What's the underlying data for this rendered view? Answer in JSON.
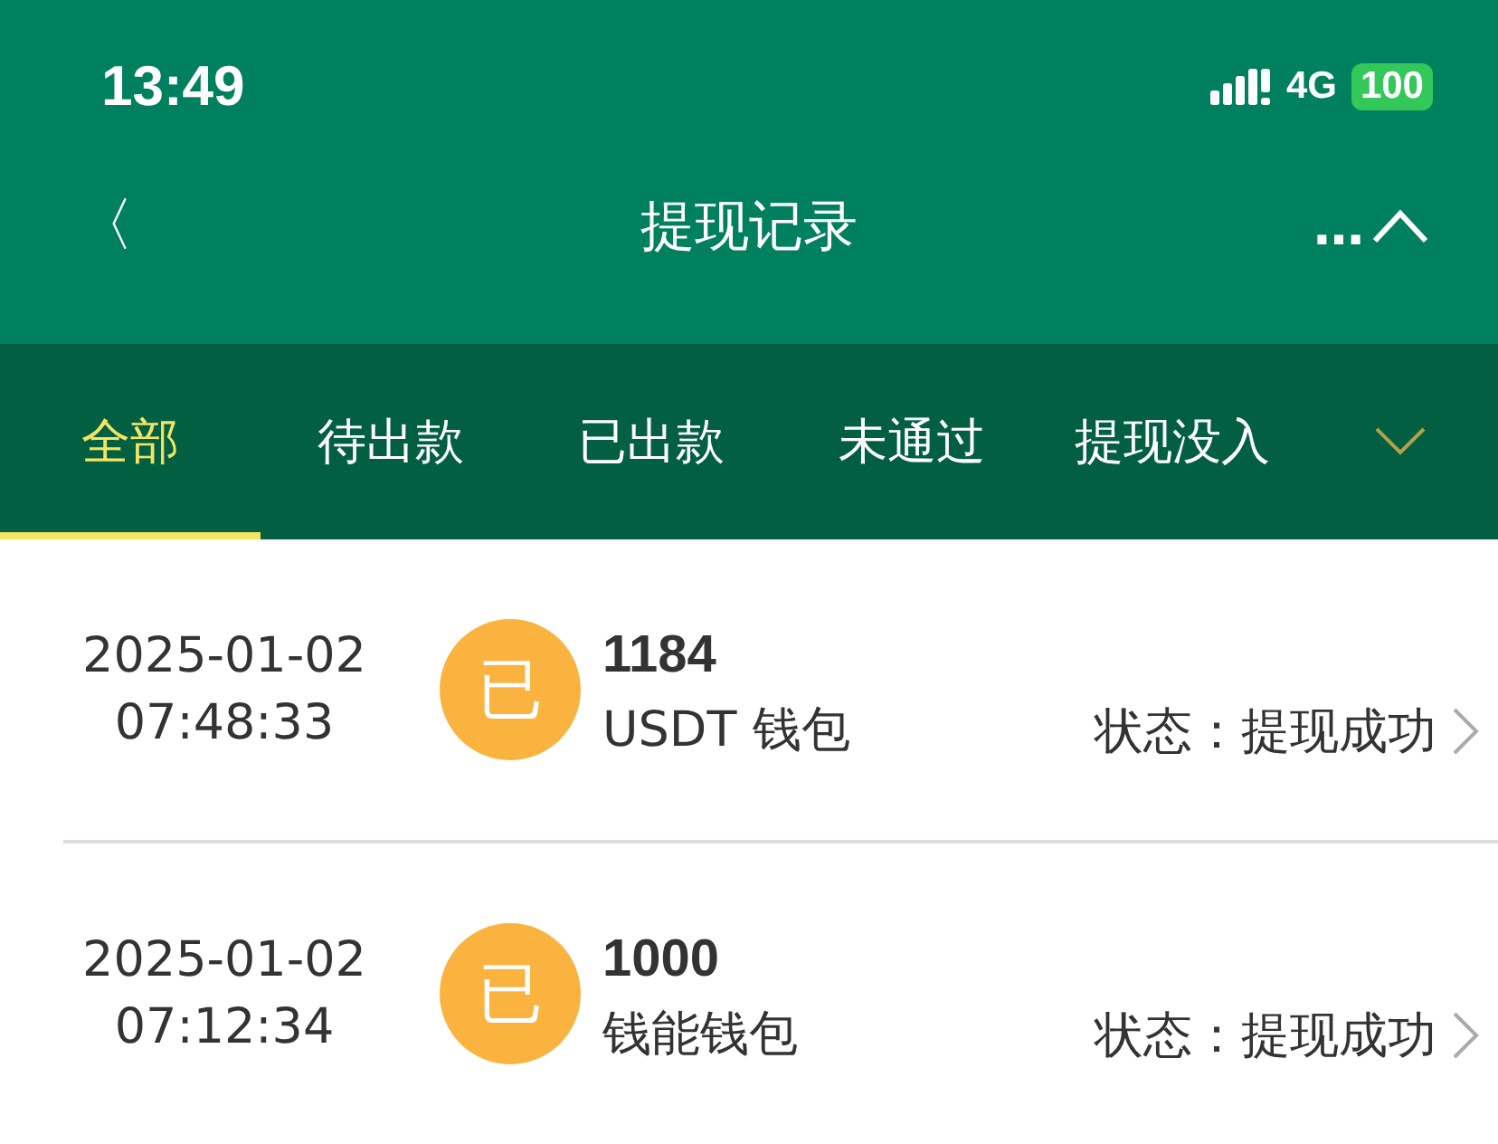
{
  "status_bar": {
    "time": "13:49",
    "network": "4G",
    "battery": "100"
  },
  "nav": {
    "back": "〈",
    "title": "提现记录",
    "more": "…"
  },
  "tabs": [
    {
      "label": "全部",
      "selected": true
    },
    {
      "label": "待出款",
      "selected": false
    },
    {
      "label": "已出款",
      "selected": false
    },
    {
      "label": "未通过",
      "selected": false
    },
    {
      "label": "提现没入",
      "selected": false
    }
  ],
  "records": [
    {
      "date": "2025-01-02",
      "time": "07:48:33",
      "badge": "已",
      "amount": "1184",
      "wallet": "USDT 钱包",
      "status": "状态：提现成功"
    },
    {
      "date": "2025-01-02",
      "time": "07:12:34",
      "badge": "已",
      "amount": "1000",
      "wallet": "钱能钱包",
      "status": "状态：提现成功"
    }
  ]
}
